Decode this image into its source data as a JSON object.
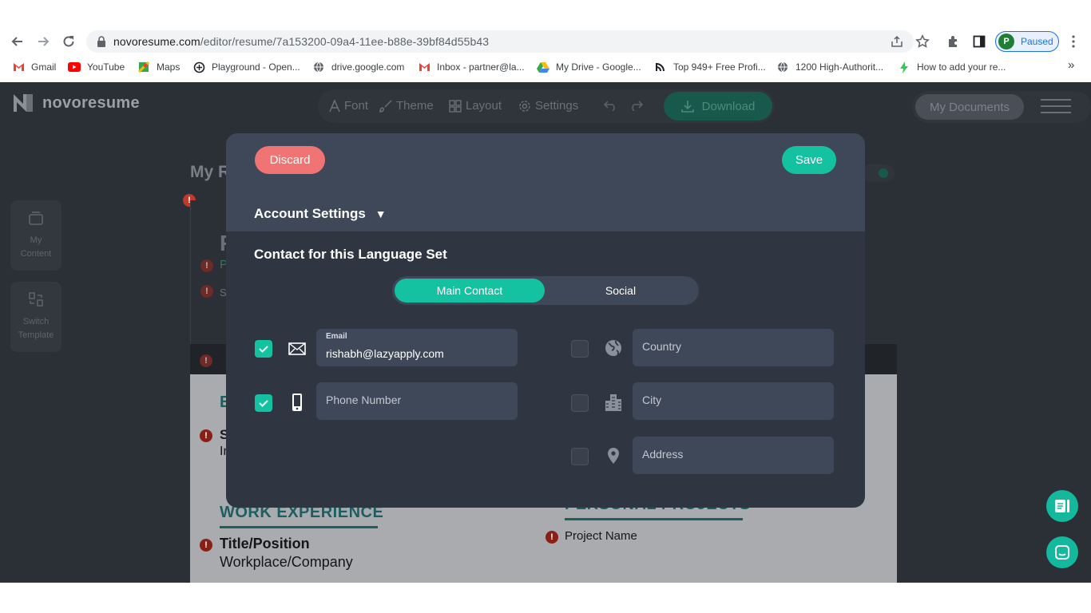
{
  "browser": {
    "url_host": "novoresume.com",
    "url_path": "/editor/resume/7a153200-09a4-11ee-b88e-39bf84d55b43",
    "profile_initial": "P",
    "profile_status": "Paused",
    "bookmarks": [
      {
        "label": "Gmail",
        "icon": "gmail-icon"
      },
      {
        "label": "YouTube",
        "icon": "youtube-icon"
      },
      {
        "label": "Maps",
        "icon": "maps-icon"
      },
      {
        "label": "Playground - Open...",
        "icon": "openai-icon"
      },
      {
        "label": "drive.google.com",
        "icon": "globe-icon"
      },
      {
        "label": "Inbox - partner@la...",
        "icon": "gmail-icon"
      },
      {
        "label": "My Drive - Google...",
        "icon": "drive-icon"
      },
      {
        "label": "Top 949+ Free Profi...",
        "icon": "site-icon"
      },
      {
        "label": "1200 High-Authorit...",
        "icon": "globe-icon"
      },
      {
        "label": "How to add your re...",
        "icon": "bolt-icon"
      }
    ],
    "more_bookmarks": "»"
  },
  "app": {
    "logo": "novoresume",
    "toolbar": {
      "font": "Font",
      "theme": "Theme",
      "layout": "Layout",
      "settings": "Settings",
      "download": "Download"
    },
    "my_documents": "My Documents",
    "sidebar": {
      "my_content": "My Content",
      "switch_template": "Switch Template"
    },
    "background": {
      "title_partial": "My R",
      "name_initial_partial": "F",
      "row1_partial": "P",
      "row2_partial": "S",
      "edu_partial": "E",
      "edu_line1_partial": "S",
      "edu_line2_partial": "In",
      "work_experience": "WORK EXPERIENCE",
      "title_position": "Title/Position",
      "workplace_company": "Workplace/Company",
      "personal_projects": "PERSONAL PROJECTS",
      "project_name": "Project Name"
    },
    "colors": {
      "accent": "#14c1a0",
      "discard": "#f07474"
    }
  },
  "modal": {
    "discard": "Discard",
    "save": "Save",
    "account_settings": "Account Settings",
    "caret": "▼",
    "contact_title": "Contact for this Language Set",
    "tabs": {
      "main": "Main Contact",
      "social": "Social"
    },
    "fields": {
      "email": {
        "label": "Email",
        "value": "rishabh@lazyapply.com",
        "checked": true
      },
      "phone": {
        "placeholder": "Phone Number",
        "checked": true
      },
      "country": {
        "placeholder": "Country",
        "checked": false
      },
      "city": {
        "placeholder": "City",
        "checked": false
      },
      "address": {
        "placeholder": "Address",
        "checked": false
      }
    }
  }
}
